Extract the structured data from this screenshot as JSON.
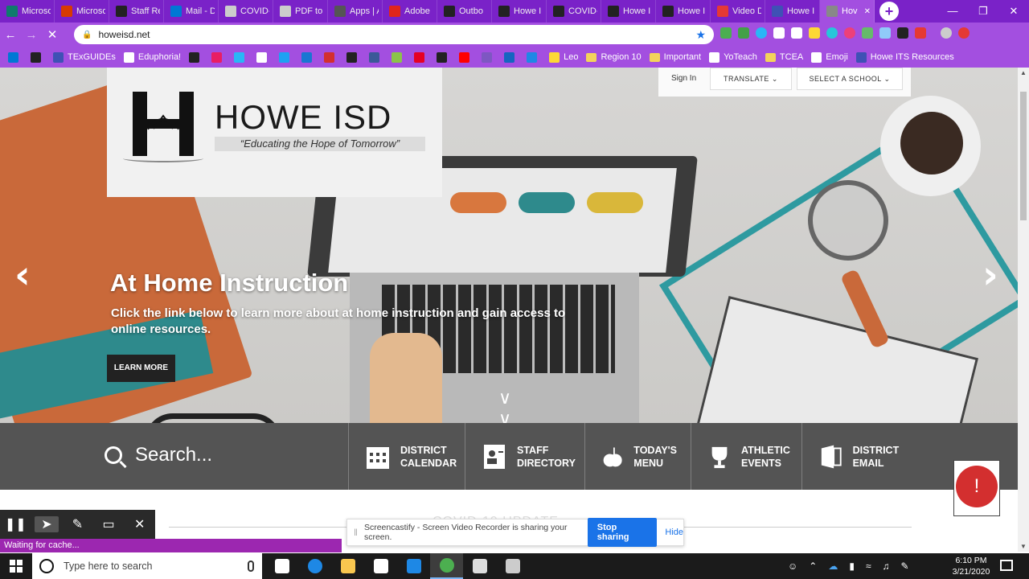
{
  "browser": {
    "tabs": [
      {
        "label": "Microso",
        "color": "#0f7b6c"
      },
      {
        "label": "Microso",
        "color": "#d83b01"
      },
      {
        "label": "Staff Re",
        "color": "#222222"
      },
      {
        "label": "Mail - D",
        "color": "#0078d4"
      },
      {
        "label": "COVID-",
        "color": "#cccccc"
      },
      {
        "label": "PDF to",
        "color": "#cccccc"
      },
      {
        "label": "Apps | A",
        "color": "#555555"
      },
      {
        "label": "Adobe",
        "color": "#e1251b"
      },
      {
        "label": "Outbo",
        "color": "#222222"
      },
      {
        "label": "Howe I",
        "color": "#222222"
      },
      {
        "label": "COVID-",
        "color": "#222222"
      },
      {
        "label": "Howe I",
        "color": "#222222"
      },
      {
        "label": "Howe I",
        "color": "#222222"
      },
      {
        "label": "Video D",
        "color": "#e53935"
      },
      {
        "label": "Howe I",
        "color": "#3f51b5"
      },
      {
        "label": "Hov",
        "color": "#888888",
        "active": true
      }
    ],
    "url": "howeisd.net",
    "bookmarks": [
      {
        "label": "",
        "color": "#0078d4"
      },
      {
        "label": "",
        "color": "#222222"
      },
      {
        "label": "TExGUIDEs",
        "color": "#3f51b5"
      },
      {
        "label": "Eduphoria!",
        "color": "#ffffff"
      },
      {
        "label": "",
        "color": "#222222"
      },
      {
        "label": "",
        "color": "#e91e63"
      },
      {
        "label": "",
        "color": "#29b6f6"
      },
      {
        "label": "",
        "color": "#ffffff"
      },
      {
        "label": "",
        "color": "#1da1f2"
      },
      {
        "label": "",
        "color": "#1976d2"
      },
      {
        "label": "",
        "color": "#d32f2f"
      },
      {
        "label": "",
        "color": "#222222"
      },
      {
        "label": "",
        "color": "#3b5998"
      },
      {
        "label": "",
        "color": "#8bc34a"
      },
      {
        "label": "",
        "color": "#e60023"
      },
      {
        "label": "",
        "color": "#222222"
      },
      {
        "label": "",
        "color": "#ff0000"
      },
      {
        "label": "",
        "color": "#7e57c2"
      },
      {
        "label": "",
        "color": "#1565c0"
      },
      {
        "label": "",
        "color": "#1e88e5"
      },
      {
        "label": "Leo",
        "color": "#fdd835"
      },
      {
        "label": "Region 10",
        "folder": true
      },
      {
        "label": "Important",
        "folder": true
      },
      {
        "label": "YoTeach",
        "color": "#ffffff"
      },
      {
        "label": "TCEA",
        "folder": true
      },
      {
        "label": "Emoji",
        "color": "#ffffff"
      },
      {
        "label": "Howe ITS Resources",
        "color": "#3f51b5"
      }
    ]
  },
  "site": {
    "logo_name": "HOWE ISD",
    "logo_tagline": "“Educating the Hope of Tomorrow”",
    "signin": "Sign In",
    "translate": "TRANSLATE",
    "select_school": "SELECT A SCHOOL",
    "hero_title": "At Home Instruction",
    "hero_subtitle": "Click the link below to learn more about at home instruction and gain access to online resources.",
    "learn_more": "LEARN MORE",
    "search_placeholder": "Search...",
    "quicklinks": [
      {
        "line1": "DISTRICT",
        "line2": "CALENDAR",
        "icon": "calendar-icon"
      },
      {
        "line1": "STAFF",
        "line2": "DIRECTORY",
        "icon": "directory-icon"
      },
      {
        "line1": "TODAY'S",
        "line2": "MENU",
        "icon": "apple-icon"
      },
      {
        "line1": "ATHLETIC",
        "line2": "EVENTS",
        "icon": "trophy-icon"
      },
      {
        "line1": "DISTRICT",
        "line2": "EMAIL",
        "icon": "email-icon"
      }
    ],
    "alert_glyph": "!",
    "covid_heading": "COVID-19 UPDATE"
  },
  "screencastify": {
    "message": "Screencastify - Screen Video Recorder is sharing your screen.",
    "stop_label": "Stop sharing",
    "hide_label": "Hide"
  },
  "status": "Waiting for cache...",
  "taskbar": {
    "search_placeholder": "Type here to search",
    "time": "6:10 PM",
    "date": "3/21/2020",
    "apps": [
      {
        "name": "task-view",
        "color": "#ffffff"
      },
      {
        "name": "edge",
        "color": "#1e88e5"
      },
      {
        "name": "file-explorer",
        "color": "#f9c74f"
      },
      {
        "name": "store",
        "color": "#ffffff"
      },
      {
        "name": "mail",
        "color": "#1e88e5"
      },
      {
        "name": "chrome",
        "color": "#4caf50",
        "active": true
      },
      {
        "name": "calculator",
        "color": "#dddddd"
      },
      {
        "name": "snip",
        "color": "#cccccc"
      }
    ]
  }
}
